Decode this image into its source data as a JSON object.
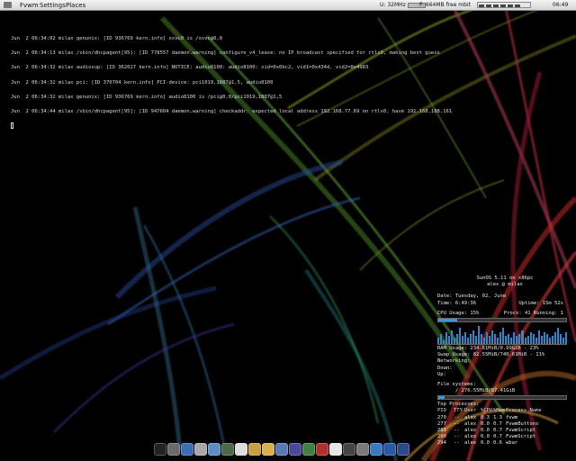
{
  "topbar": {
    "menus": [
      "Fvwm",
      "Settings",
      "Places"
    ],
    "stats": [
      "U: 32MHz",
      "F: 664MB free mbit"
    ],
    "clock": "06:49"
  },
  "terminal": {
    "lines": [
      "Jun  2 06:34:02 milax genunix: [ID 936769 kern.info] xsvc0 is /xsvc@0,0",
      "Jun  2 06:34:13 milax /sbin/dhcpagent[95]: [ID 778557 daemon.warning] configure_v4_lease: no IP broadcast specified for rtls0, making best guess",
      "Jun  2 06:34:32 milax audiosup: [ID 362027 kern.info] NOTICE: audio8100: audio8100: xid=0x0bc2, vid1=0x434d, vid2=0x4983",
      "Jun  2 06:34:32 milax pci: [ID 370704 kern.info] PCI-device: pci1019,1887@1,5, audio8100",
      "Jun  2 06:34:32 milax genunix: [ID 936769 kern.info] audio8100 is /pci@0,0/pci1019,1887@1,5",
      "Jun  2 06:34:44 milax /sbin/dhcpagent[95]: [ID 947604 daemon.warning] checkaddr: expected local address 192.168.77.69 on rtls0, have 192.168.188.161"
    ]
  },
  "conky": {
    "system": "SunOS 5.11 on x86pc",
    "user": "alex @ milax",
    "date_label": "Date:",
    "date": "Tuesday, 02. June",
    "time_label": "Time:",
    "time": "6:49:36",
    "uptime_label": "Uptime:",
    "uptime": "15m 52s",
    "cpu": "CPU Usage: 15%",
    "procs": "Procs: 41  Running: 1",
    "cpu_fraction": 0.15,
    "cpu_graph": [
      0.3,
      0.5,
      0.2,
      0.6,
      0.4,
      0.7,
      0.3,
      0.5,
      0.8,
      0.4,
      0.6,
      0.3,
      0.5,
      0.7,
      0.4,
      0.9,
      0.5,
      0.3,
      0.6,
      0.4,
      0.7,
      0.5,
      0.3,
      0.6,
      0.8,
      0.4,
      0.5,
      0.3,
      0.6,
      0.4,
      0.5,
      0.7,
      0.3,
      0.4,
      0.6,
      0.5,
      0.3,
      0.7,
      0.4,
      0.6,
      0.5,
      0.3,
      0.4,
      0.6,
      0.8,
      0.5,
      0.3,
      0.6
    ],
    "ram": "RAM Usage: 234.61MiB/0.99GiB - 23%",
    "ram_fraction": 0.23,
    "swap": "Swap Usage: 82.55MiB/740.61MiB - 11%",
    "swap_fraction": 0.11,
    "networking": "Networking:",
    "down": "Down:",
    "up": "Up:",
    "file_systems": "File systems:",
    "fs_usage": "/ 276.55MiB/87.41GiB",
    "fs_fraction": 0.05,
    "top_processes": "Top Processes:",
    "proc_header": [
      "PID",
      "TTY",
      "User",
      "%CPU",
      "%Mem",
      "Process Name"
    ],
    "processes": [
      [
        "270",
        "--",
        "alex",
        "0.3",
        "1.3",
        "fvwm"
      ],
      [
        "277",
        "--",
        "alex",
        "0.0",
        "0.7",
        "FvwmButtons"
      ],
      [
        "289",
        "--",
        "alex",
        "0.0",
        "0.7",
        "FvwmScript"
      ],
      [
        "290",
        "--",
        "alex",
        "0.0",
        "0.7",
        "FvwmScript"
      ],
      [
        "294",
        "--",
        "alex",
        "0.0",
        "0.6",
        "wbar"
      ]
    ]
  },
  "dock": {
    "icons": [
      {
        "name": "terminal-icon",
        "color": "#222222"
      },
      {
        "name": "mixer-icon",
        "color": "#6a6a6a"
      },
      {
        "name": "globe-icon",
        "color": "#3a6fb5"
      },
      {
        "name": "mail-icon",
        "color": "#a8a8a8"
      },
      {
        "name": "network-icon",
        "color": "#5b8fc4"
      },
      {
        "name": "display-icon",
        "color": "#4a6a4a"
      },
      {
        "name": "x-icon",
        "color": "#dddddd"
      },
      {
        "name": "notes-icon",
        "color": "#c8a040"
      },
      {
        "name": "folder-icon",
        "color": "#d8b050"
      },
      {
        "name": "files-icon",
        "color": "#5a7ab5"
      },
      {
        "name": "package-icon",
        "color": "#4a4a9a"
      },
      {
        "name": "pen-icon",
        "color": "#408040"
      },
      {
        "name": "book-icon",
        "color": "#b03030"
      },
      {
        "name": "help-icon",
        "color": "#e6e6e6"
      },
      {
        "name": "plug-icon",
        "color": "#444444"
      },
      {
        "name": "gear-icon",
        "color": "#7a7a7a"
      },
      {
        "name": "system-icon",
        "color": "#3a7ac0"
      },
      {
        "name": "search-icon",
        "color": "#2a5aa5"
      },
      {
        "name": "power-icon",
        "color": "#2a4a8a"
      }
    ]
  }
}
